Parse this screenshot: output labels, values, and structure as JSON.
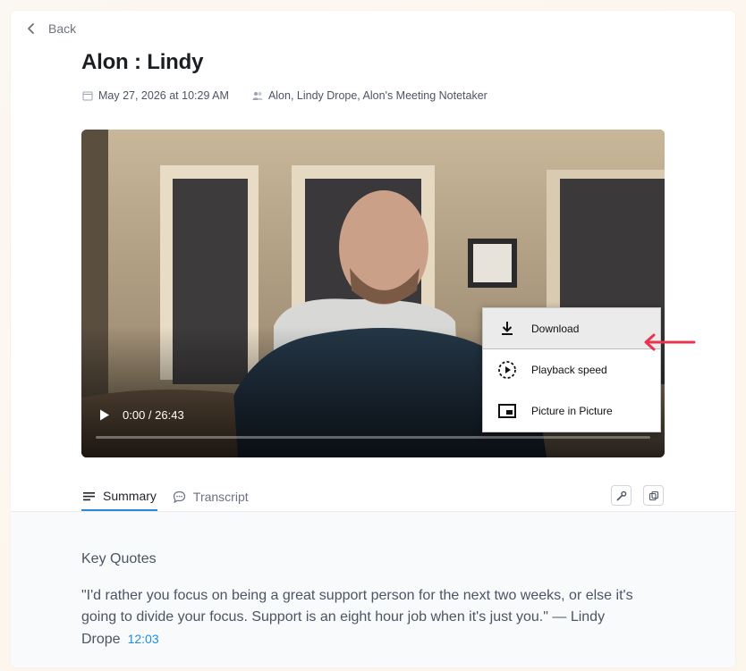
{
  "nav": {
    "back_label": "Back"
  },
  "meeting": {
    "title": "Alon : Lindy",
    "date": "May 27, 2026 at 10:29 AM",
    "participants": "Alon, Lindy Drope, Alon's Meeting Notetaker"
  },
  "player": {
    "time": "0:00 / 26:43",
    "progress": 0,
    "menu": [
      {
        "label": "Download",
        "icon": "download-icon",
        "highlighted": true
      },
      {
        "label": "Playback speed",
        "icon": "playback-speed-icon",
        "highlighted": false
      },
      {
        "label": "Picture in Picture",
        "icon": "picture-in-picture-icon",
        "highlighted": false
      }
    ]
  },
  "tabs": [
    {
      "label": "Summary",
      "icon": "lines-icon",
      "active": true
    },
    {
      "label": "Transcript",
      "icon": "chat-bubble-icon",
      "active": false
    }
  ],
  "summary": {
    "section_title": "Key Quotes",
    "quote_text": "\"I'd rather you focus on being a great support person for the next two weeks, or else it's going to divide your focus. Support is an eight hour job when it's just you.\" — Lindy Drope",
    "quote_timestamp": "12:03"
  },
  "colors": {
    "accent": "#2b8ad8",
    "link": "#1d8fe0",
    "arrow": "#e8344e"
  }
}
